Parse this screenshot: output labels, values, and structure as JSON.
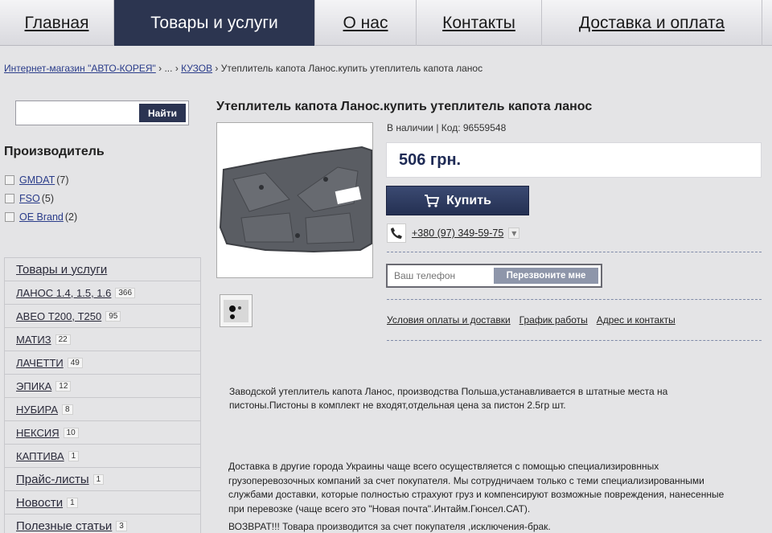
{
  "topnav": {
    "items": [
      "Главная",
      "Товары и услуги",
      "О нас",
      "Контакты",
      "Доставка и оплата"
    ],
    "active_index": 1
  },
  "breadcrumb": {
    "home": "Интернет-магазин \"АВТО-КОРЕЯ\"",
    "sep1": " › ... › ",
    "section": "КУЗОВ",
    "sep2": " › ",
    "current": "Утеплитель капота Ланос.купить утеплитель капота ланос"
  },
  "search": {
    "placeholder": "",
    "button": "Найти"
  },
  "filter": {
    "title": "Производитель",
    "items": [
      {
        "name": "GMDAT",
        "count": "(7)"
      },
      {
        "name": "FSO",
        "count": "(5)"
      },
      {
        "name": "OE Brand",
        "count": "(2)"
      }
    ]
  },
  "categories": [
    {
      "label": "Товары и услуги",
      "count": "",
      "big": true
    },
    {
      "label": "ЛАНОС 1.4, 1.5, 1.6",
      "count": "366",
      "big": false
    },
    {
      "label": "АВЕО Т200, Т250",
      "count": "95",
      "big": false
    },
    {
      "label": "МАТИЗ",
      "count": "22",
      "big": false
    },
    {
      "label": "ЛАЧЕТТИ",
      "count": "49",
      "big": false
    },
    {
      "label": "ЭПИКА",
      "count": "12",
      "big": false
    },
    {
      "label": "НУБИРА",
      "count": "8",
      "big": false
    },
    {
      "label": "НЕКСИЯ",
      "count": "10",
      "big": false
    },
    {
      "label": "КАПТИВА",
      "count": "1",
      "big": false
    },
    {
      "label": "Прайс-листы",
      "count": "1",
      "big": true
    },
    {
      "label": "Новости",
      "count": "1",
      "big": true
    },
    {
      "label": "Полезные статьи",
      "count": "3",
      "big": true
    }
  ],
  "product": {
    "title": "Утеплитель капота Ланос.купить утеплитель капота ланос",
    "availability": "В наличии | Код: 96559548",
    "price": "506 грн.",
    "buy_label": "Купить",
    "phone": "+380 (97) 349-59-75",
    "callback_placeholder": "Ваш телефон",
    "callback_button": "Перезвоните мне",
    "links": [
      "Условия оплаты и доставки",
      "График работы",
      "Адрес и контакты"
    ],
    "description_1": "Заводской утеплитель капота Ланос, производства Польша,устанавливается в штатные места на",
    "description_2": "пистоны.Пистоны в комплект не входят,отдельная цена за пистон 2.5гр шт.",
    "delivery_1": "Доставка в другие города Украины чаще всего осуществляется с помощью специализировнных",
    "delivery_2": "грузоперевозочных компаний за счет покупателя. Мы сотрудничаем только с теми специализированными",
    "delivery_3": "службами доставки, которые полностью страхуют груз и компенсируют возможные повреждения, нанесенные",
    "delivery_4": "при перевозке (чаще всего это \"Новая почта\".Интайм.Гюнсел.САТ).",
    "return_text": "ВОЗВРАТ!!! Товара производится за счет покупателя ,исключения-брак."
  }
}
